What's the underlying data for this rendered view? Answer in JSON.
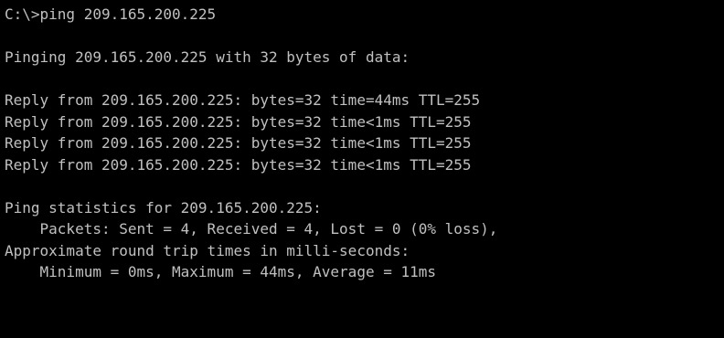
{
  "terminal": {
    "text_color": "#c0c0c0",
    "background_color": "#000000",
    "lines": [
      "C:\\>ping 209.165.200.225",
      "",
      "Pinging 209.165.200.225 with 32 bytes of data:",
      "",
      "Reply from 209.165.200.225: bytes=32 time=44ms TTL=255",
      "Reply from 209.165.200.225: bytes=32 time<1ms TTL=255",
      "Reply from 209.165.200.225: bytes=32 time<1ms TTL=255",
      "Reply from 209.165.200.225: bytes=32 time<1ms TTL=255",
      "",
      "Ping statistics for 209.165.200.225:",
      "    Packets: Sent = 4, Received = 4, Lost = 0 (0% loss),",
      "Approximate round trip times in milli-seconds:",
      "    Minimum = 0ms, Maximum = 44ms, Average = 11ms"
    ]
  }
}
